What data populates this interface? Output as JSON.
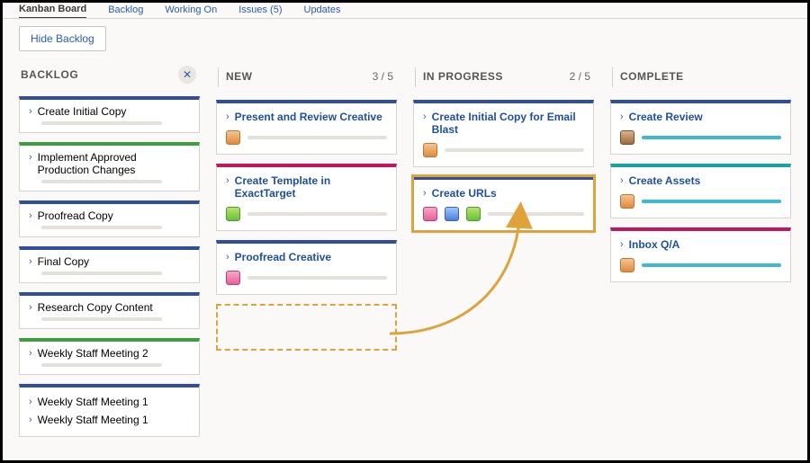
{
  "tabs": {
    "kanban": "Kanban Board",
    "backlog": "Backlog",
    "working": "Working On",
    "issues": "Issues (5)",
    "updates": "Updates"
  },
  "toolbar": {
    "hide_backlog": "Hide Backlog"
  },
  "columns": {
    "backlog": {
      "title": "BACKLOG"
    },
    "new": {
      "title": "NEW",
      "count": "3 / 5"
    },
    "inprogress": {
      "title": "IN PROGRESS",
      "count": "2 / 5"
    },
    "complete": {
      "title": "COMPLETE"
    }
  },
  "backlog_items": [
    {
      "title": "Create Initial Copy",
      "color": "blue"
    },
    {
      "title": "Implement Approved Production Changes",
      "color": "green"
    },
    {
      "title": "Proofread Copy",
      "color": "blue"
    },
    {
      "title": "Final Copy",
      "color": "blue"
    },
    {
      "title": "Research Copy Content",
      "color": "blue"
    },
    {
      "title": "Weekly Staff Meeting 2",
      "color": "green"
    },
    {
      "title_a": "Weekly Staff Meeting 1",
      "title_b": "Weekly Staff Meeting 1",
      "color": "blue",
      "stacked": true
    }
  ],
  "new_items": [
    {
      "title": "Present and Review Creative",
      "color": "blue"
    },
    {
      "title": "Create Template in ExactTarget",
      "color": "pink"
    },
    {
      "title": "Proofread Creative",
      "color": "blue"
    }
  ],
  "inprogress_items": [
    {
      "title": "Create Initial Copy for Email Blast",
      "color": "blue"
    },
    {
      "title": "Create URLs",
      "color": "blue",
      "selected": true
    }
  ],
  "complete_items": [
    {
      "title": "Create Review",
      "color": "blue"
    },
    {
      "title": "Create Assets",
      "color": "teal"
    },
    {
      "title": "Inbox Q/A",
      "color": "pink"
    }
  ]
}
